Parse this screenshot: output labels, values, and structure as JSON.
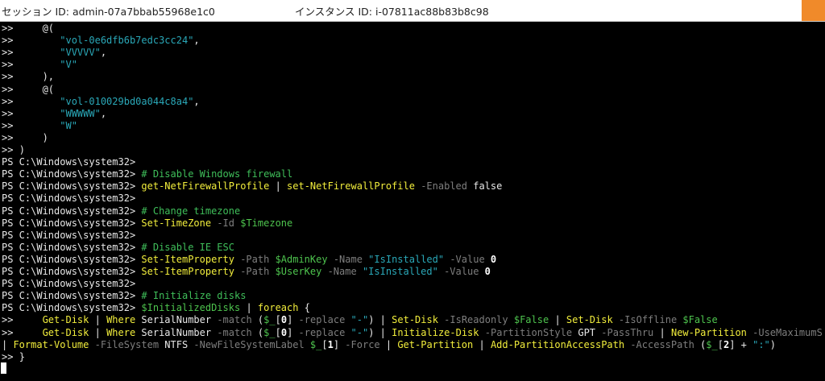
{
  "header": {
    "session": "セッション ID: admin-07a7bbab55968e1c0",
    "instance": "インスタンス ID: i-07811ac88b83b8c98"
  },
  "terminal": {
    "lines": [
      [
        [
          "p",
          ">>"
        ],
        [
          "t",
          "     @("
        ]
      ],
      [
        [
          "p",
          ">>"
        ],
        [
          "t",
          "        "
        ],
        [
          "s",
          "\"vol-0e6dfb6b7edc3cc24\""
        ],
        [
          "t",
          ","
        ]
      ],
      [
        [
          "p",
          ">>"
        ],
        [
          "t",
          "        "
        ],
        [
          "s",
          "\"VVVVV\""
        ],
        [
          "t",
          ","
        ]
      ],
      [
        [
          "p",
          ">>"
        ],
        [
          "t",
          "        "
        ],
        [
          "s",
          "\"V\""
        ]
      ],
      [
        [
          "p",
          ">>"
        ],
        [
          "t",
          "     ),"
        ]
      ],
      [
        [
          "p",
          ">>"
        ],
        [
          "t",
          "     @("
        ]
      ],
      [
        [
          "p",
          ">>"
        ],
        [
          "t",
          "        "
        ],
        [
          "s",
          "\"vol-010029bd0a044c8a4\""
        ],
        [
          "t",
          ","
        ]
      ],
      [
        [
          "p",
          ">>"
        ],
        [
          "t",
          "        "
        ],
        [
          "s",
          "\"WWWWW\""
        ],
        [
          "t",
          ","
        ]
      ],
      [
        [
          "p",
          ">>"
        ],
        [
          "t",
          "        "
        ],
        [
          "s",
          "\"W\""
        ]
      ],
      [
        [
          "p",
          ">>"
        ],
        [
          "t",
          "     )"
        ]
      ],
      [
        [
          "p",
          ">> "
        ],
        [
          "t",
          ")"
        ]
      ],
      [
        [
          "p",
          "PS C:\\Windows\\system32>"
        ]
      ],
      [
        [
          "p",
          "PS C:\\Windows\\system32> "
        ],
        [
          "c",
          "# Disable Windows firewall"
        ]
      ],
      [
        [
          "p",
          "PS C:\\Windows\\system32> "
        ],
        [
          "cmd",
          "get-NetFirewallProfile"
        ],
        [
          "t",
          " | "
        ],
        [
          "cmd",
          "set-NetFirewallProfile"
        ],
        [
          "prm",
          " -Enabled "
        ],
        [
          "t",
          "false"
        ]
      ],
      [
        [
          "p",
          "PS C:\\Windows\\system32>"
        ]
      ],
      [
        [
          "p",
          "PS C:\\Windows\\system32> "
        ],
        [
          "c",
          "# Change timezone"
        ]
      ],
      [
        [
          "p",
          "PS C:\\Windows\\system32> "
        ],
        [
          "cmd",
          "Set-TimeZone"
        ],
        [
          "prm",
          " -Id "
        ],
        [
          "v",
          "$Timezone"
        ]
      ],
      [
        [
          "p",
          "PS C:\\Windows\\system32>"
        ]
      ],
      [
        [
          "p",
          "PS C:\\Windows\\system32> "
        ],
        [
          "c",
          "# Disable IE ESC"
        ]
      ],
      [
        [
          "p",
          "PS C:\\Windows\\system32> "
        ],
        [
          "cmd",
          "Set-ItemProperty"
        ],
        [
          "prm",
          " -Path "
        ],
        [
          "v",
          "$AdminKey"
        ],
        [
          "prm",
          " -Name "
        ],
        [
          "s",
          "\"IsInstalled\""
        ],
        [
          "prm",
          " -Value "
        ],
        [
          "n",
          "0"
        ]
      ],
      [
        [
          "p",
          "PS C:\\Windows\\system32> "
        ],
        [
          "cmd",
          "Set-ItemProperty"
        ],
        [
          "prm",
          " -Path "
        ],
        [
          "v",
          "$UserKey"
        ],
        [
          "prm",
          " -Name "
        ],
        [
          "s",
          "\"IsInstalled\""
        ],
        [
          "prm",
          " -Value "
        ],
        [
          "n",
          "0"
        ]
      ],
      [
        [
          "p",
          "PS C:\\Windows\\system32>"
        ]
      ],
      [
        [
          "p",
          "PS C:\\Windows\\system32> "
        ],
        [
          "c",
          "# Initialize disks"
        ]
      ],
      [
        [
          "p",
          "PS C:\\Windows\\system32> "
        ],
        [
          "v",
          "$InitializedDisks"
        ],
        [
          "t",
          " | "
        ],
        [
          "cmd",
          "foreach"
        ],
        [
          "t",
          " {"
        ]
      ],
      [
        [
          "p",
          ">>     "
        ],
        [
          "cmd",
          "Get-Disk"
        ],
        [
          "t",
          " | "
        ],
        [
          "cmd",
          "Where"
        ],
        [
          "t",
          " SerialNumber"
        ],
        [
          "prm",
          " -match "
        ],
        [
          "t",
          "("
        ],
        [
          "v",
          "$_"
        ],
        [
          "t",
          "["
        ],
        [
          "n",
          "0"
        ],
        [
          "t",
          "]"
        ],
        [
          "prm",
          " -replace "
        ],
        [
          "s",
          "\"-\""
        ],
        [
          "t",
          ") | "
        ],
        [
          "cmd",
          "Set-Disk"
        ],
        [
          "prm",
          " -IsReadonly "
        ],
        [
          "v",
          "$False"
        ],
        [
          "t",
          " | "
        ],
        [
          "cmd",
          "Set-Disk"
        ],
        [
          "prm",
          " -IsOffline "
        ],
        [
          "v",
          "$False"
        ]
      ],
      [
        [
          "p",
          ">>     "
        ],
        [
          "cmd",
          "Get-Disk"
        ],
        [
          "t",
          " | "
        ],
        [
          "cmd",
          "Where"
        ],
        [
          "t",
          " SerialNumber"
        ],
        [
          "prm",
          " -match "
        ],
        [
          "t",
          "("
        ],
        [
          "v",
          "$_"
        ],
        [
          "t",
          "["
        ],
        [
          "n",
          "0"
        ],
        [
          "t",
          "]"
        ],
        [
          "prm",
          " -replace "
        ],
        [
          "s",
          "\"-\""
        ],
        [
          "t",
          ") | "
        ],
        [
          "cmd",
          "Initialize-Disk"
        ],
        [
          "prm",
          " -PartitionStyle "
        ],
        [
          "t",
          "GPT"
        ],
        [
          "prm",
          " -PassThru "
        ],
        [
          "t",
          "| "
        ],
        [
          "cmd",
          "New-Partition"
        ],
        [
          "prm",
          " -UseMaximumS"
        ]
      ],
      [
        [
          "t",
          "| "
        ],
        [
          "cmd",
          "Format-Volume"
        ],
        [
          "prm",
          " -FileSystem "
        ],
        [
          "t",
          "NTFS"
        ],
        [
          "prm",
          " -NewFileSystemLabel "
        ],
        [
          "v",
          "$_"
        ],
        [
          "t",
          "["
        ],
        [
          "n",
          "1"
        ],
        [
          "t",
          "]"
        ],
        [
          "prm",
          " -Force "
        ],
        [
          "t",
          "| "
        ],
        [
          "cmd",
          "Get-Partition"
        ],
        [
          "t",
          " | "
        ],
        [
          "cmd",
          "Add-PartitionAccessPath"
        ],
        [
          "prm",
          " -AccessPath "
        ],
        [
          "t",
          "("
        ],
        [
          "v",
          "$_"
        ],
        [
          "t",
          "["
        ],
        [
          "n",
          "2"
        ],
        [
          "t",
          "]"
        ],
        [
          "t",
          " + "
        ],
        [
          "s",
          "\":\""
        ],
        [
          "t",
          ")"
        ]
      ],
      [
        [
          "p",
          ">> "
        ],
        [
          "t",
          "}"
        ]
      ]
    ]
  }
}
